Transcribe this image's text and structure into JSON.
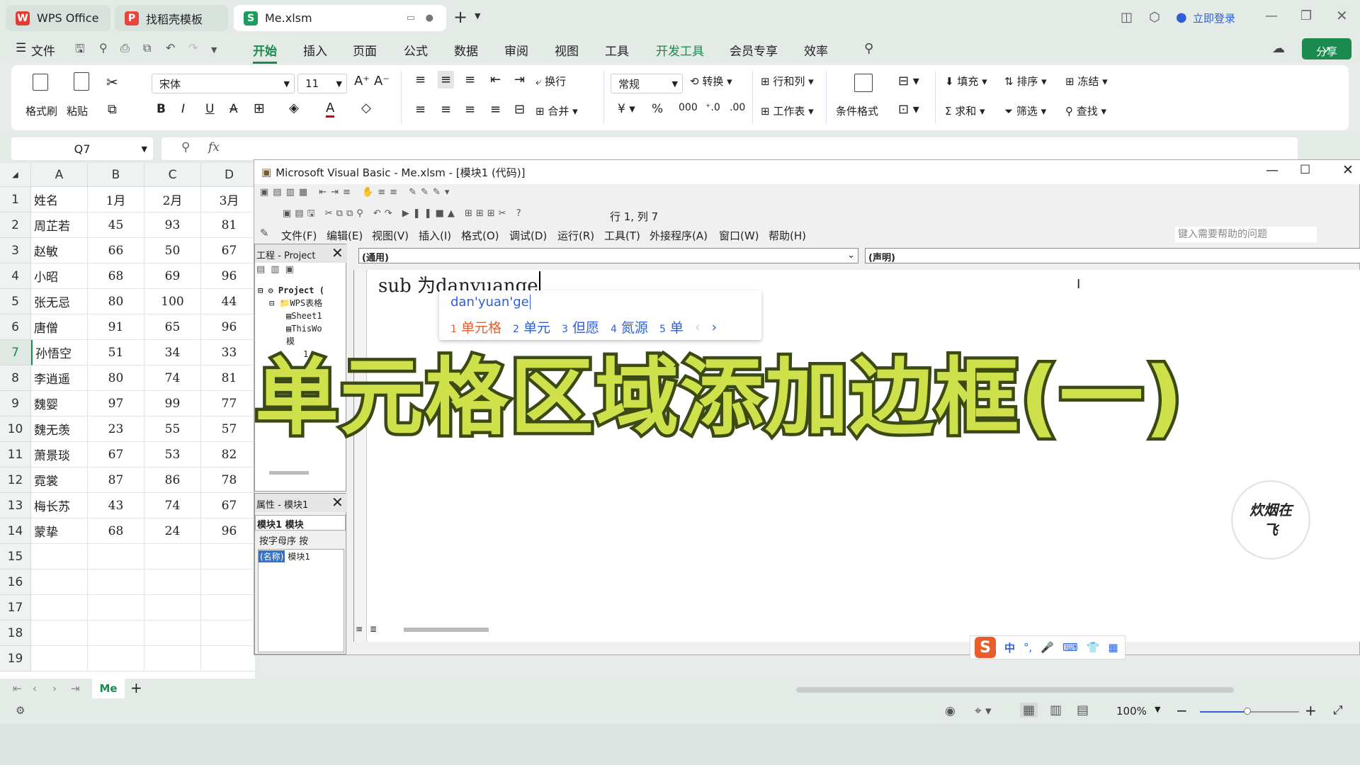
{
  "tabs": [
    {
      "label": "WPS Office"
    },
    {
      "label": "找稻壳模板"
    },
    {
      "label": "Me.xlsm"
    }
  ],
  "account": "立即登录",
  "menu": {
    "file": "文件",
    "items": [
      "开始",
      "插入",
      "页面",
      "公式",
      "数据",
      "审阅",
      "视图",
      "工具",
      "开发工具",
      "会员专享",
      "效率"
    ],
    "share": "分享"
  },
  "ribbon": {
    "format_painter": "格式刷",
    "paste": "粘贴",
    "font": "宋体",
    "font_size": "11",
    "wrap": "换行",
    "merge": "合并",
    "number_format": "常规",
    "convert": "转换",
    "rowcol": "行和列",
    "worksheet": "工作表",
    "cond_format": "条件格式",
    "fill": "填充",
    "sort": "排序",
    "freeze": "冻结",
    "sum": "求和",
    "filter": "筛选",
    "find": "查找"
  },
  "formula": {
    "name_box": "Q7",
    "fx": "fx"
  },
  "sheet": {
    "columns": [
      "A",
      "B",
      "C",
      "D"
    ],
    "rows": [
      [
        "1",
        "姓名",
        "1月",
        "2月",
        "3月"
      ],
      [
        "2",
        "周芷若",
        "45",
        "93",
        "81"
      ],
      [
        "3",
        "赵敏",
        "66",
        "50",
        "67"
      ],
      [
        "4",
        "小昭",
        "68",
        "69",
        "96"
      ],
      [
        "5",
        "张无忌",
        "80",
        "100",
        "44"
      ],
      [
        "6",
        "唐僧",
        "91",
        "65",
        "96"
      ],
      [
        "7",
        "孙悟空",
        "51",
        "34",
        "33"
      ],
      [
        "8",
        "李逍遥",
        "80",
        "74",
        "81"
      ],
      [
        "9",
        "魏婴",
        "97",
        "99",
        "77"
      ],
      [
        "10",
        "魏无羡",
        "23",
        "55",
        "57"
      ],
      [
        "11",
        "萧景琰",
        "67",
        "53",
        "82"
      ],
      [
        "12",
        "霓裳",
        "87",
        "86",
        "78"
      ],
      [
        "13",
        "梅长苏",
        "43",
        "74",
        "67"
      ],
      [
        "14",
        "蒙挚",
        "68",
        "24",
        "96"
      ],
      [
        "15",
        "",
        "",
        "",
        ""
      ],
      [
        "16",
        "",
        "",
        "",
        ""
      ],
      [
        "17",
        "",
        "",
        "",
        ""
      ],
      [
        "18",
        "",
        "",
        "",
        ""
      ],
      [
        "19",
        "",
        "",
        "",
        ""
      ]
    ],
    "sheet_tab": "Me"
  },
  "vba": {
    "title": "Microsoft Visual Basic - Me.xlsm - [模块1 (代码)]",
    "position": "行 1, 列 7",
    "menus": [
      "文件(F)",
      "编辑(E)",
      "视图(V)",
      "插入(I)",
      "格式(O)",
      "调试(D)",
      "运行(R)",
      "工具(T)",
      "外接程序(A)",
      "窗口(W)",
      "帮助(H)"
    ],
    "help_placeholder": "键入需要帮助的问题",
    "proj_title": "工程 - Project",
    "tree": [
      "Project (",
      "WPS表格",
      "Sheet1",
      "ThisWo",
      "模",
      "1"
    ],
    "prop_title": "属性 - 模块1",
    "prop_select": "模块1 模块",
    "prop_tabs": "按字母序  按",
    "prop_row_key": "(名称)",
    "prop_row_val": "模块1",
    "general": "(通用)",
    "declarations": "(声明)",
    "code_text": "sub 为danyuange"
  },
  "ime": {
    "pinyin": "dan'yuan'ge",
    "candidates": [
      {
        "n": "1",
        "w": "单元格"
      },
      {
        "n": "2",
        "w": "单元"
      },
      {
        "n": "3",
        "w": "但愿"
      },
      {
        "n": "4",
        "w": "氮源"
      },
      {
        "n": "5",
        "w": "单"
      }
    ]
  },
  "ime_bar": "中",
  "overlay": "单元格区域添加边框(一)",
  "watermark": "炊烟在飞",
  "status": {
    "zoom": "100%"
  }
}
